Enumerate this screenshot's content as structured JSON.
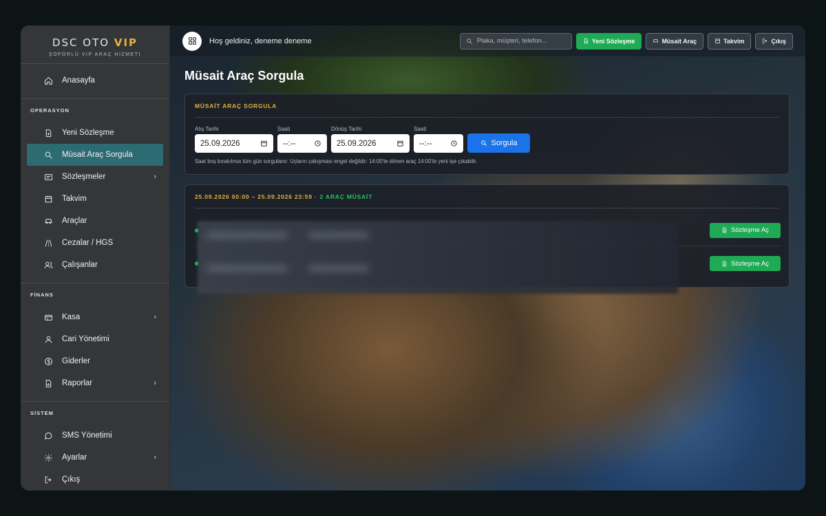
{
  "brand": {
    "title_main": "DSC OTO",
    "title_accent": "VIP",
    "subtitle": "ŞOFÖRLÜ VIP ARAÇ HİZMETİ"
  },
  "sidebar": {
    "home": "Anasayfa",
    "sections": {
      "operations": "OPERASYON",
      "finance": "FİNANS",
      "system": "SİSTEM"
    },
    "operations": [
      "Yeni Sözleşme",
      "Müsait Araç Sorgula",
      "Sözleşmeler",
      "Takvim",
      "Araçlar",
      "Cezalar / HGS",
      "Çalışanlar"
    ],
    "finance": [
      "Kasa",
      "Cari Yönetimi",
      "Giderler",
      "Raporlar"
    ],
    "system": [
      "SMS Yönetimi",
      "Ayarlar",
      "Çıkış"
    ],
    "active": "Müsait Araç Sorgula"
  },
  "topbar": {
    "welcome": "Hoş geldiniz, deneme deneme",
    "search_placeholder": "Plaka, müşteri, telefon...",
    "new_contract": "Yeni Sözleşme",
    "available": "Müsait Araç",
    "calendar": "Takvim",
    "logout": "Çıkış"
  },
  "page": {
    "title": "Müsait Araç Sorgula"
  },
  "query_card": {
    "heading": "MÜSAİT ARAÇ SORGULA",
    "pickup_label": "Alış Tarihi",
    "pickup_date": "25.09.2026",
    "pickup_time_label": "Saati",
    "pickup_time": "--:--",
    "return_label": "Dönüş Tarihi",
    "return_date": "25.09.2026",
    "return_time_label": "Saati",
    "return_time": "--:--",
    "submit": "Sorgula",
    "hint": "Saat boş bırakılırsa tüm gün sorgulanır. Uçların çakışması engel değildir: 14:00'te dönen araç 14:00'te yeni işe çıkabilir."
  },
  "results": {
    "range": "25.09.2026 00:00 – 25.09.2026 23:59 ·",
    "count": "2 ARAÇ MÜSAİT",
    "rows": [
      {
        "action": "Sözleşme Aç"
      },
      {
        "action": "Sözleşme Aç"
      }
    ]
  },
  "colors": {
    "accent_gold": "#e3b23c",
    "success_green": "#1faa55",
    "primary_blue": "#1a73e8",
    "active_teal": "#2d6b73"
  }
}
